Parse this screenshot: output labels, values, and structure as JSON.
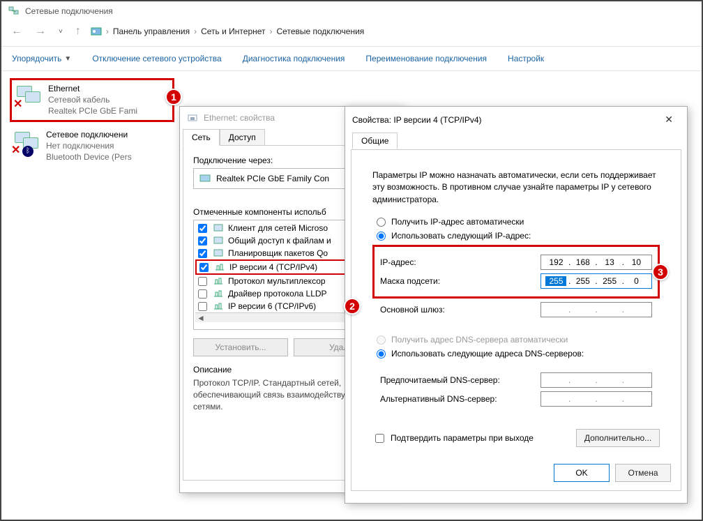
{
  "explorer": {
    "title": "Сетевые подключения",
    "breadcrumb": [
      "Панель управления",
      "Сеть и Интернет",
      "Сетевые подключения"
    ]
  },
  "toolbar": {
    "organize": "Упорядочить",
    "disable": "Отключение сетевого устройства",
    "diagnose": "Диагностика подключения",
    "rename": "Переименование подключения",
    "settings": "Настройк"
  },
  "connections": [
    {
      "name": "Ethernet",
      "line2": "Сетевой кабель",
      "line3": "Realtek PCIe GbE Fami",
      "highlighted": true,
      "error": true,
      "bluetooth": false
    },
    {
      "name": "Сетевое подключени",
      "line2": "Нет подключения",
      "line3": "Bluetooth Device (Pers",
      "highlighted": false,
      "error": true,
      "bluetooth": true
    }
  ],
  "dialog1": {
    "title": "Ethernet: свойства",
    "tabs": {
      "network": "Сеть",
      "access": "Доступ"
    },
    "connect_via_label": "Подключение через:",
    "adapter": "Realtek PCIe GbE Family Con",
    "components_label": "Отмеченные компоненты испольб",
    "components": [
      {
        "checked": true,
        "label": "Клиент для сетей Microso"
      },
      {
        "checked": true,
        "label": "Общий доступ к файлам и"
      },
      {
        "checked": true,
        "label": "Планировщик пакетов Qo"
      },
      {
        "checked": true,
        "label": "IP версии 4 (TCP/IPv4)",
        "highlighted": true
      },
      {
        "checked": false,
        "label": "Протокол мультиплексор"
      },
      {
        "checked": false,
        "label": "Драйвер протокола LLDP"
      },
      {
        "checked": false,
        "label": "IP версии 6 (TCP/IPv6)"
      }
    ],
    "buttons": {
      "install": "Установить...",
      "uninstall": "Удали"
    },
    "desc_label": "Описание",
    "desc_text": "Протокол TCP/IP. Стандартный сетей, обеспечивающий связь взаимодействующими сетями."
  },
  "dialog2": {
    "title": "Свойства: IP версии 4 (TCP/IPv4)",
    "tab_general": "Общие",
    "info": "Параметры IP можно назначать автоматически, если сеть поддерживает эту возможность. В противном случае узнайте параметры IP у сетевого администратора.",
    "radio_auto_ip": "Получить IP-адрес автоматически",
    "radio_manual_ip": "Использовать следующий IP-адрес:",
    "ip_label": "IP-адрес:",
    "ip_value": [
      "192",
      "168",
      "13",
      "10"
    ],
    "mask_label": "Маска подсети:",
    "mask_value": [
      "255",
      "255",
      "255",
      "0"
    ],
    "mask_selected_octet": 0,
    "gateway_label": "Основной шлюз:",
    "radio_auto_dns": "Получить адрес DNS-сервера автоматически",
    "radio_manual_dns": "Использовать следующие адреса DNS-серверов:",
    "dns1_label": "Предпочитаемый DNS-сервер:",
    "dns2_label": "Альтернативный DNS-сервер:",
    "validate_label": "Подтвердить параметры при выходе",
    "advanced_btn": "Дополнительно...",
    "ok_btn": "OK",
    "cancel_btn": "Отмена"
  },
  "annotations": {
    "a1": "1",
    "a2": "2",
    "a3": "3"
  }
}
